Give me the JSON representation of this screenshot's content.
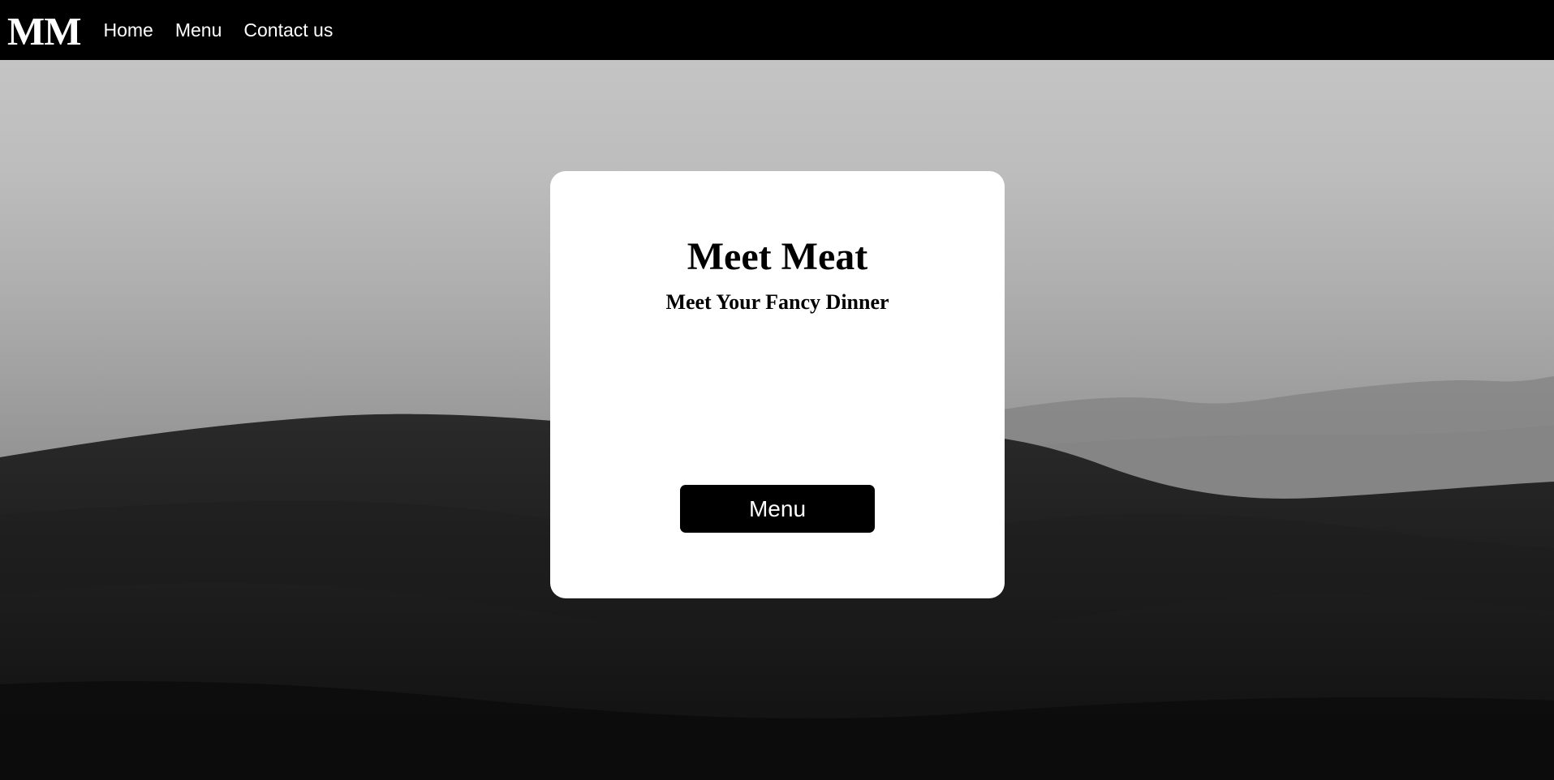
{
  "navbar": {
    "logo": "MM",
    "links": [
      {
        "label": "Home"
      },
      {
        "label": "Menu"
      },
      {
        "label": "Contact us"
      }
    ]
  },
  "hero": {
    "background": "grayscale desert dunes with distant hills"
  },
  "card": {
    "title": "Meet Meat",
    "subtitle": "Meet Your Fancy Dinner",
    "button_label": "Menu"
  },
  "colors": {
    "navbar_bg": "#000000",
    "nav_text": "#ffffff",
    "card_bg": "#ffffff",
    "button_bg": "#000000",
    "button_text": "#ffffff"
  }
}
